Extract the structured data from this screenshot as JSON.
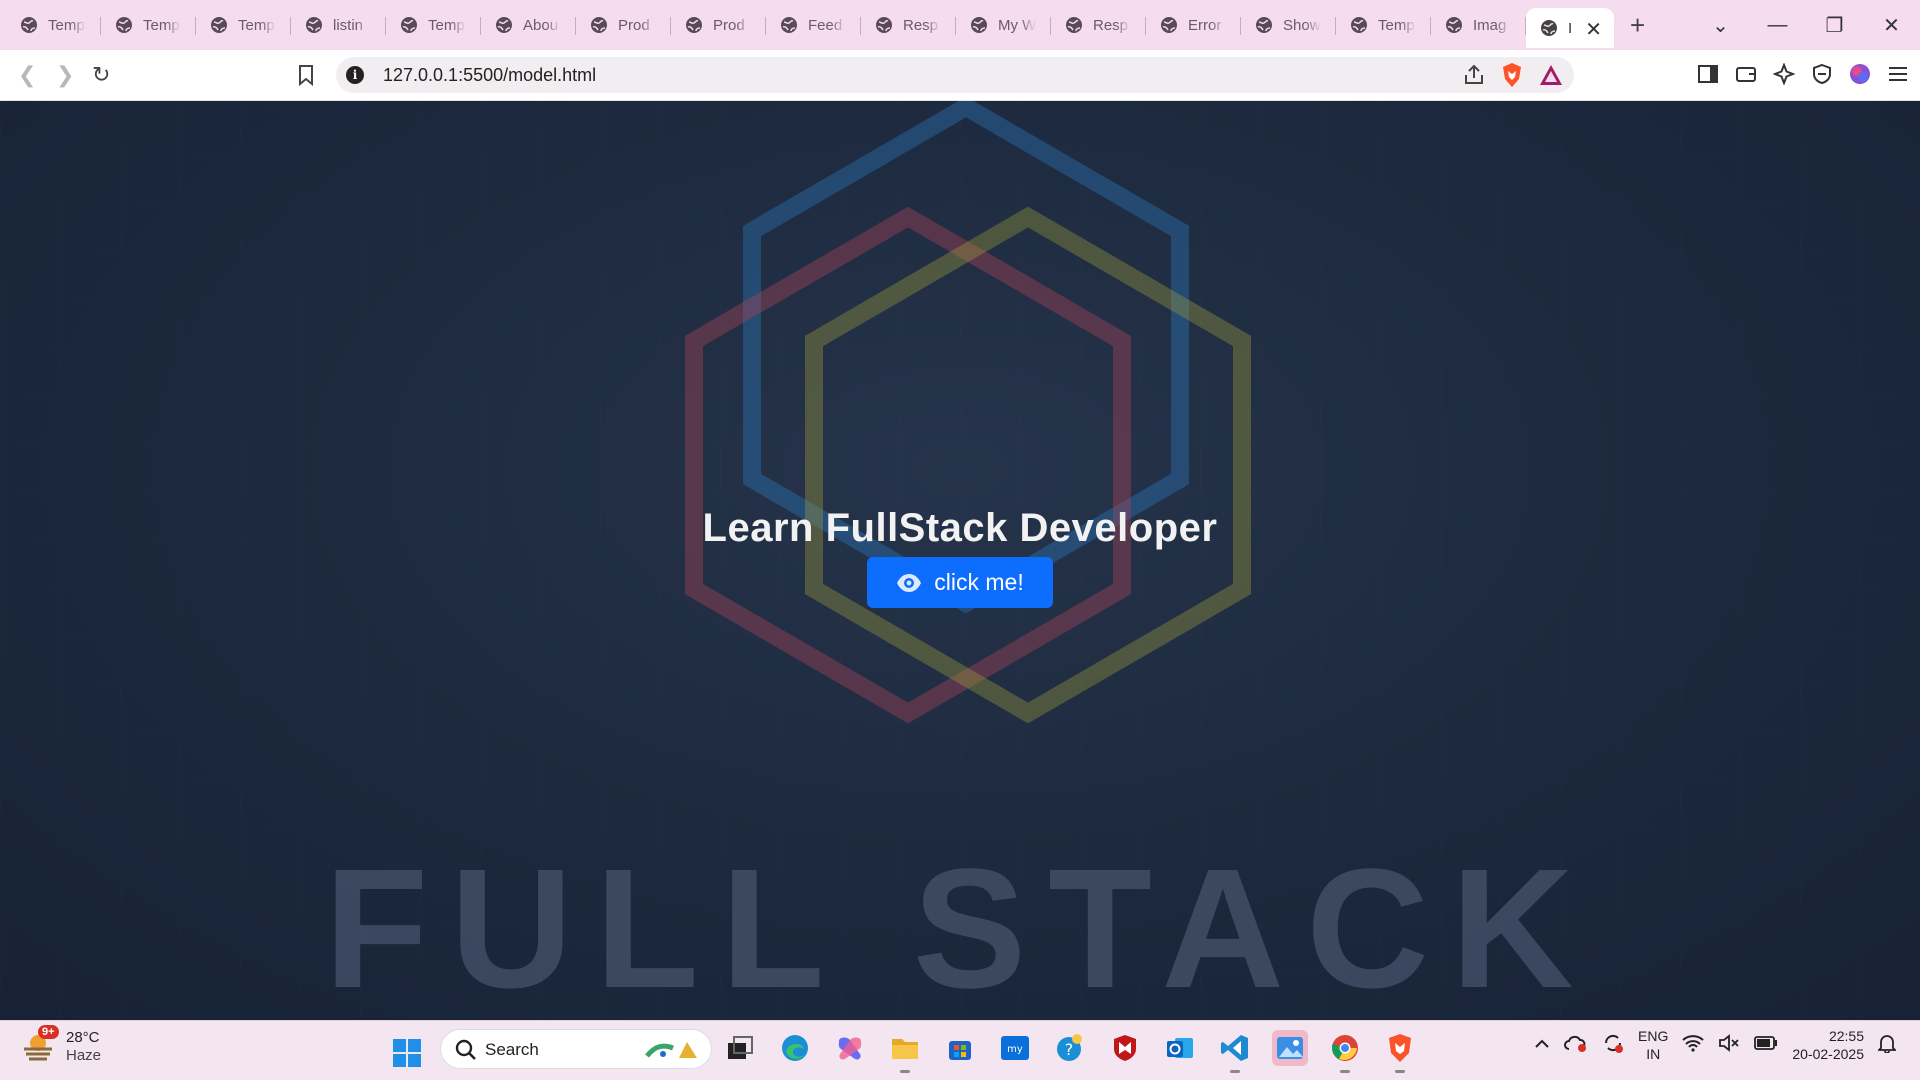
{
  "browser": {
    "tabs": [
      {
        "label": "Temp"
      },
      {
        "label": "Temp"
      },
      {
        "label": "Temp"
      },
      {
        "label": "listin"
      },
      {
        "label": "Temp"
      },
      {
        "label": "Abou"
      },
      {
        "label": "Prod"
      },
      {
        "label": "Prod"
      },
      {
        "label": "Feed"
      },
      {
        "label": "Resp"
      },
      {
        "label": "My W"
      },
      {
        "label": "Resp"
      },
      {
        "label": "Error"
      },
      {
        "label": "Show"
      },
      {
        "label": "Temp"
      },
      {
        "label": "Imag"
      }
    ],
    "active_tab": {
      "label": "I"
    },
    "url": "127.0.0.1:5500/model.html"
  },
  "page": {
    "title": "Learn FullStack Developer",
    "button_label": "click me!",
    "background_word": "FULL STACK"
  },
  "taskbar": {
    "weather": {
      "temp": "28°C",
      "condition": "Haze",
      "badge": "9+"
    },
    "search_placeholder": "Search",
    "lang": {
      "line1": "ENG",
      "line2": "IN"
    },
    "clock": {
      "time": "22:55",
      "date": "20-02-2025"
    }
  },
  "colors": {
    "accent": "#0d6efd",
    "tabbar": "#f6dcef",
    "page_bg": "#1d2a3f"
  }
}
